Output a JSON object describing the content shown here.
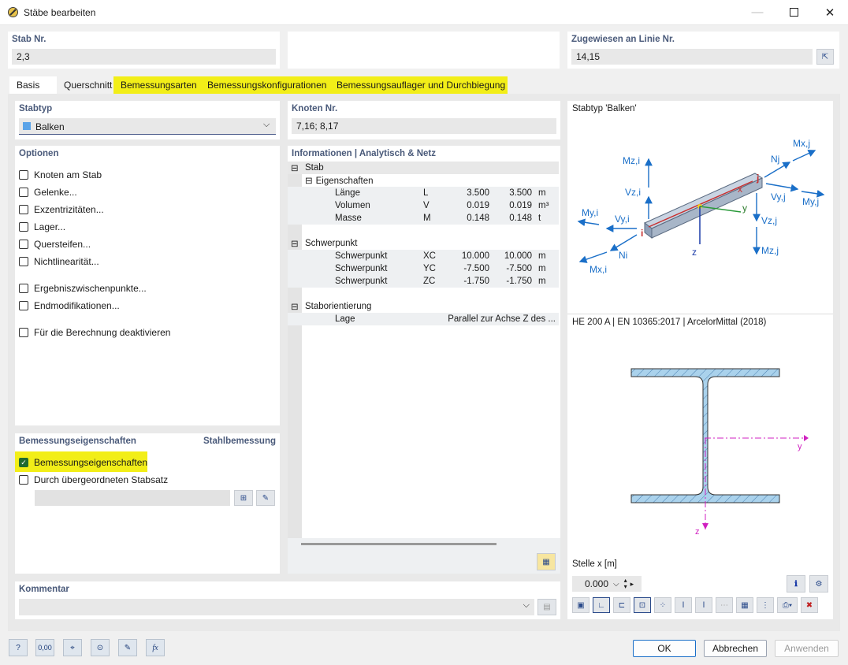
{
  "window": {
    "title": "Stäbe bearbeiten"
  },
  "top": {
    "stab_label": "Stab Nr.",
    "stab_value": "2,3",
    "linie_label": "Zugewiesen an Linie Nr.",
    "linie_value": "14,15"
  },
  "tabs": [
    {
      "label": "Basis"
    },
    {
      "label": "Querschnitt"
    },
    {
      "label": "Bemessungsarten"
    },
    {
      "label": "Bemessungskonfigurationen"
    },
    {
      "label": "Bemessungsauflager und Durchbiegung"
    }
  ],
  "stabtyp": {
    "label": "Stabtyp",
    "value": "Balken",
    "color": "#5aa3e8"
  },
  "optionen": {
    "label": "Optionen",
    "items": [
      {
        "label": "Knoten am Stab"
      },
      {
        "label": "Gelenke..."
      },
      {
        "label": "Exzentrizitäten..."
      },
      {
        "label": "Lager..."
      },
      {
        "label": "Quersteifen..."
      },
      {
        "label": "Nichtlinearität..."
      },
      {
        "label": "Ergebniszwischenpunkte..."
      },
      {
        "label": "Endmodifikationen..."
      },
      {
        "label": "Für die Berechnung deaktivieren"
      }
    ]
  },
  "bemessung": {
    "label": "Bemessungseigenschaften",
    "right": "Stahlbemessung",
    "cb1": "Bemessungseigenschaften",
    "cb2": "Durch übergeordneten Stabsatz"
  },
  "knoten": {
    "label": "Knoten Nr.",
    "value": "7,16; 8,17"
  },
  "info": {
    "label": "Informationen | Analytisch & Netz",
    "stab": "Stab",
    "eigenschaften": "Eigenschaften",
    "eig_rows": [
      {
        "name": "Länge",
        "sym": "L",
        "v1": "3.500",
        "v2": "3.500",
        "unit": "m"
      },
      {
        "name": "Volumen",
        "sym": "V",
        "v1": "0.019",
        "v2": "0.019",
        "unit": "m³"
      },
      {
        "name": "Masse",
        "sym": "M",
        "v1": "0.148",
        "v2": "0.148",
        "unit": "t"
      }
    ],
    "schwerpunkt": "Schwerpunkt",
    "sp_rows": [
      {
        "name": "Schwerpunkt",
        "sym": "XC",
        "v1": "10.000",
        "v2": "10.000",
        "unit": "m"
      },
      {
        "name": "Schwerpunkt",
        "sym": "YC",
        "v1": "-7.500",
        "v2": "-7.500",
        "unit": "m"
      },
      {
        "name": "Schwerpunkt",
        "sym": "ZC",
        "v1": "-1.750",
        "v2": "-1.750",
        "unit": "m"
      }
    ],
    "orient": "Staborientierung",
    "lage_name": "Lage",
    "lage_value": "Parallel zur Achse Z des ..."
  },
  "preview": {
    "title": "Stabtyp 'Balken'",
    "labels": {
      "mzi": "Mz,i",
      "vzi": "Vz,i",
      "myi": "My,i",
      "vyi": "Vy,i",
      "ni": "Ni",
      "mxi": "Mx,i",
      "i": "i",
      "j": "j",
      "x": "x",
      "y": "y",
      "z": "z",
      "nj": "Nj",
      "mxj": "Mx,j",
      "vyj": "Vy,j",
      "myj": "My,j",
      "vzj": "Vz,j",
      "mzj": "Mz,j"
    },
    "section": "HE 200 A | EN 10365:2017 | ArcelorMittal (2018)",
    "sec_y": "y",
    "sec_z": "z",
    "stelle_label": "Stelle x [m]",
    "stelle_value": "0.000"
  },
  "kommentar": {
    "label": "Kommentar"
  },
  "buttons": {
    "ok": "OK",
    "cancel": "Abbrechen",
    "apply": "Anwenden"
  },
  "colors": {
    "highlight": "#f2ee18",
    "accent": "#1a6fc8",
    "steel": "#aad2ec"
  }
}
